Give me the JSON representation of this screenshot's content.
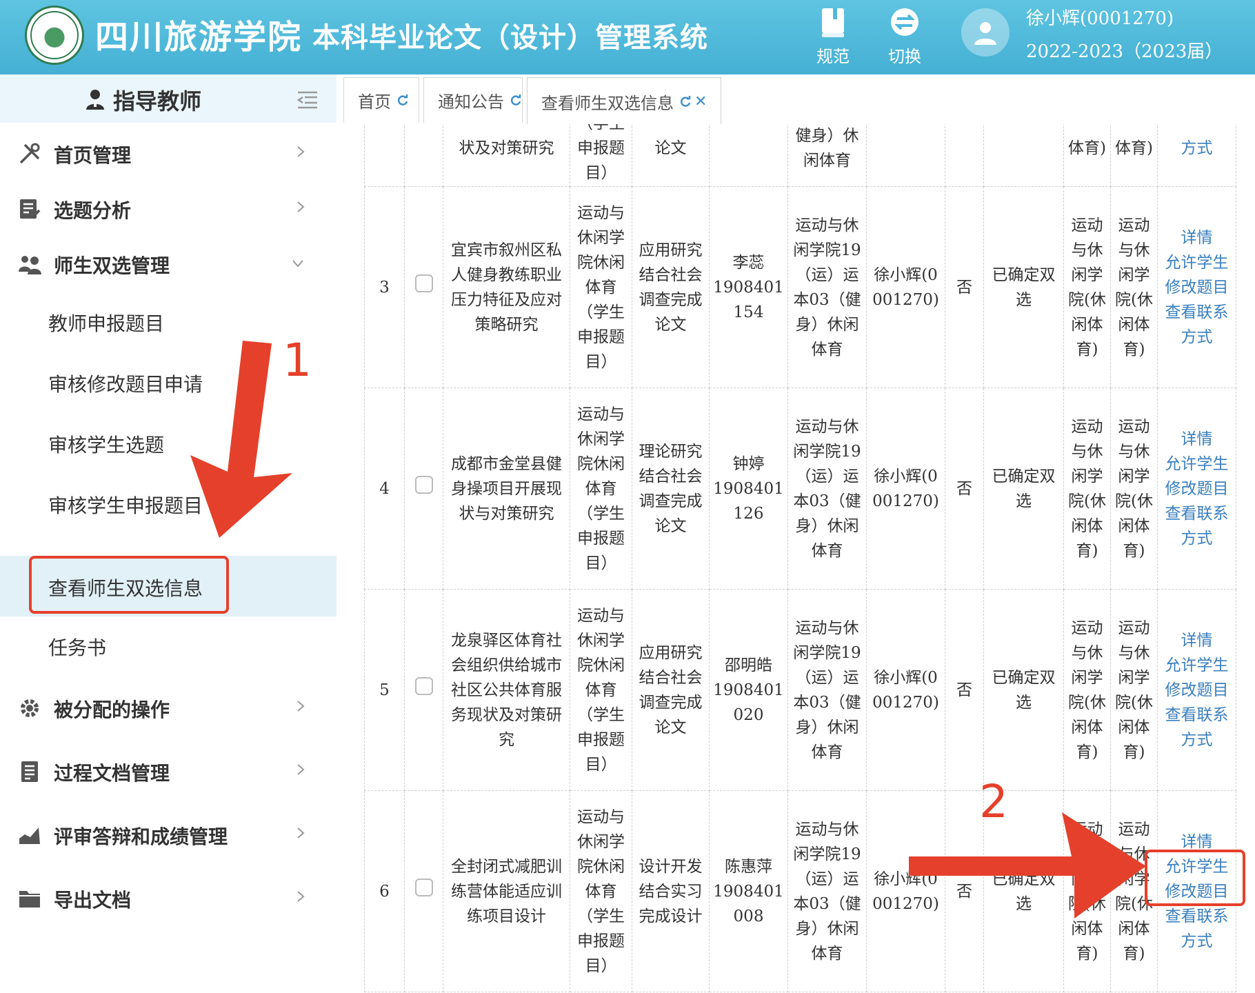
{
  "header": {
    "school_name": "四川旅游学院",
    "system_name": "本科毕业论文（设计）管理系统",
    "buttons": [
      {
        "label": "规范",
        "icon": "book-icon"
      },
      {
        "label": "切换",
        "icon": "switch-icon"
      }
    ],
    "user_name": "徐小辉(0001270)",
    "term": "2022-2023（2023届）"
  },
  "sidebar": {
    "role_title": "指导教师",
    "menu": [
      {
        "label": "首页管理",
        "icon": "tools-icon"
      },
      {
        "label": "选题分析",
        "icon": "edit-doc-icon"
      },
      {
        "label": "师生双选管理",
        "icon": "users-icon"
      },
      {
        "label": "被分配的操作",
        "icon": "gear-icon"
      },
      {
        "label": "过程文档管理",
        "icon": "document-icon"
      },
      {
        "label": "评审答辩和成绩管理",
        "icon": "chart-icon"
      },
      {
        "label": "导出文档",
        "icon": "folder-icon"
      }
    ],
    "submenu": [
      {
        "label": "教师申报题目"
      },
      {
        "label": "审核修改题目申请"
      },
      {
        "label": "审核学生选题"
      },
      {
        "label": "审核学生申报题目"
      },
      {
        "label": "查看师生双选信息"
      },
      {
        "label": "任务书"
      }
    ]
  },
  "tabs": [
    {
      "label": "首页"
    },
    {
      "label": "通知公告"
    },
    {
      "label": "查看师生双选信息"
    }
  ],
  "table": {
    "partial_row": {
      "title": "状及对策研究",
      "source": "（学生申报题目）",
      "type": "论文",
      "class": "健身）休闲体育",
      "dept1": "体育)",
      "dept2": "体育)",
      "ops": "方式"
    },
    "rows": [
      {
        "no": "3",
        "title": "宜宾市叙州区私人健身教练职业压力特征及应对策略研究",
        "source": "运动与休闲学院休闲体育（学生申报题目）",
        "type": "应用研究结合社会调查完成论文",
        "student": "李蕊",
        "student_id": "1908401154",
        "class": "运动与休闲学院19（运）运本03（健身）休闲体育",
        "teacher": "徐小辉(0001270)",
        "flag": "否",
        "status": "已确定双选",
        "dept1": "运动与休闲学院(休闲体育)",
        "dept2": "运动与休闲学院(休闲体育)"
      },
      {
        "no": "4",
        "title": "成都市金堂县健身操项目开展现状与对策研究",
        "source": "运动与休闲学院休闲体育（学生申报题目）",
        "type": "理论研究结合社会调查完成论文",
        "student": "钟婷",
        "student_id": "1908401126",
        "class": "运动与休闲学院19（运）运本03（健身）休闲体育",
        "teacher": "徐小辉(0001270)",
        "flag": "否",
        "status": "已确定双选",
        "dept1": "运动与休闲学院(休闲体育)",
        "dept2": "运动与休闲学院(休闲体育)"
      },
      {
        "no": "5",
        "title": "龙泉驿区体育社会组织供给城市社区公共体育服务现状及对策研究",
        "source": "运动与休闲学院休闲体育（学生申报题目）",
        "type": "应用研究结合社会调查完成论文",
        "student": "邵明皓",
        "student_id": "1908401020",
        "class": "运动与休闲学院19（运）运本03（健身）休闲体育",
        "teacher": "徐小辉(0001270)",
        "flag": "否",
        "status": "已确定双选",
        "dept1": "运动与休闲学院(休闲体育)",
        "dept2": "运动与休闲学院(休闲体育)"
      },
      {
        "no": "6",
        "title": "全封闭式减肥训练营体能适应训练项目设计",
        "source": "运动与休闲学院休闲体育（学生申报题目）",
        "type": "设计开发结合实习完成设计",
        "student": "陈惠萍",
        "student_id": "1908401008",
        "class": "运动与休闲学院19（运）运本03（健身）休闲体育",
        "teacher": "徐小辉(0001270)",
        "flag": "否",
        "status": "已确定双选",
        "dept1": "运动与休闲学院(休闲体育)",
        "dept2": "运动与休闲学院(休闲体育)"
      }
    ],
    "ops": {
      "detail": "详情",
      "allow": "允许学生修改题目",
      "contact": "查看联系方式"
    }
  },
  "annotations": [
    {
      "label": "1"
    },
    {
      "label": "2"
    }
  ],
  "colors": {
    "header": "#4fb9db",
    "active_bg": "#e2f1f8",
    "accent_red": "#e5402b",
    "link": "#3a7fbf",
    "status_green": "#2e9e2e"
  }
}
